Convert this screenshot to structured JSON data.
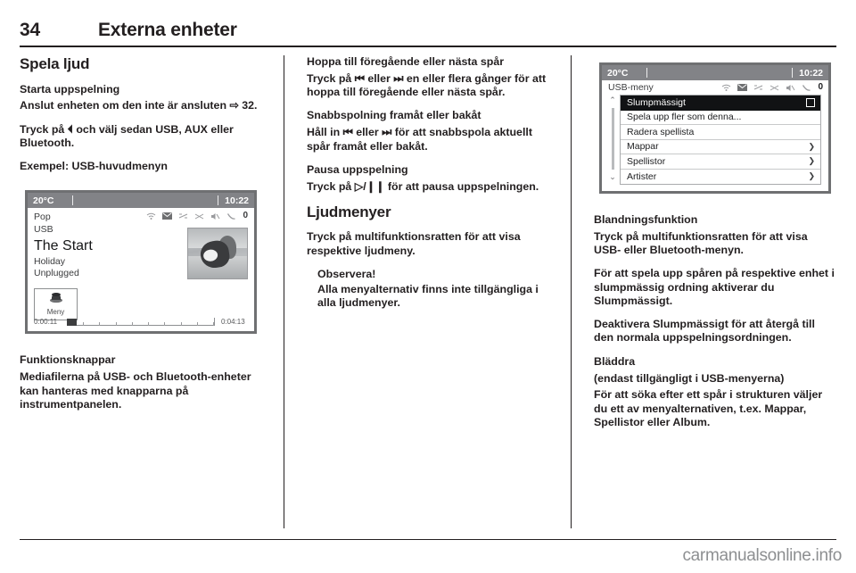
{
  "header": {
    "page_number": "34",
    "title": "Externa enheter"
  },
  "column1": {
    "section_title": "Spela ljud",
    "sub1": "Starta uppspelning",
    "para1": "Anslut enheten om den inte är ansluten ⇨ 32.",
    "para2": "Tryck på ⏴ och välj sedan USB, AUX eller Bluetooth.",
    "caption": "Exempel: USB-huvudmenyn",
    "sub2": "Funktionsknappar",
    "para3": "Mediafilerna på USB- och Bluetooth-enheter kan hanteras med knapparna på instrumentpanelen."
  },
  "player_screen": {
    "temperature": "20°C",
    "clock": "10:22",
    "genre": "Pop",
    "source": "USB",
    "track_title": "The Start",
    "album": "Holiday",
    "artist": "Unplugged",
    "menu_button_label": "Meny",
    "elapsed_time": "0:00:11",
    "total_time": "0:04:13",
    "status_icons": [
      "wifi-icon",
      "envelope-icon",
      "repeat-off-icon",
      "shuffle-icon",
      "mute-icon",
      "phone-icon",
      "battery-icon"
    ],
    "battery_label": "0"
  },
  "column2": {
    "sub1": "Hoppa till föregående eller nästa spår",
    "para1": "Tryck på ⏮ eller ⏭ en eller flera gånger för att hoppa till föregående eller nästa spår.",
    "sub2": "Snabbspolning framåt eller bakåt",
    "para2": "Håll in ⏮ eller ⏭ för att snabbspola aktuellt spår framåt eller bakåt.",
    "sub3": "Pausa uppspelning",
    "para3": "Tryck på ▷/❙❙ för att pausa uppspelningen.",
    "section_title": "Ljudmenyer",
    "para4": "Tryck på multifunktionsratten för att visa respektive ljudmeny.",
    "note_title": "Observera!",
    "note_text": "Alla menyalternativ finns inte tillgängliga i alla ljudmenyer."
  },
  "menu_screen": {
    "temperature": "20°C",
    "clock": "10:22",
    "menu_title": "USB-meny",
    "battery_label": "0",
    "status_icons": [
      "wifi-icon",
      "envelope-icon",
      "repeat-off-icon",
      "shuffle-icon",
      "mute-icon",
      "phone-icon",
      "battery-icon"
    ],
    "items": [
      {
        "label": "Slumpmässigt",
        "selected": true,
        "control": "checkbox"
      },
      {
        "label": "Spela upp fler som denna...",
        "selected": false,
        "control": "none"
      },
      {
        "label": "Radera  spellista",
        "selected": false,
        "control": "none"
      },
      {
        "label": "Mappar",
        "selected": false,
        "control": "arrow"
      },
      {
        "label": "Spellistor",
        "selected": false,
        "control": "arrow"
      },
      {
        "label": "Artister",
        "selected": false,
        "control": "arrow"
      }
    ],
    "scroll_up": "⌃",
    "scroll_down": "⌄"
  },
  "column3": {
    "sub1": "Blandningsfunktion",
    "para1": "Tryck på multifunktionsratten för att visa USB- eller Bluetooth-menyn.",
    "para2": "För att spela upp spåren på respektive enhet i slumpmässig ordning aktiverar du Slumpmässigt.",
    "para3": "Deaktivera Slumpmässigt för att återgå till den normala uppspelningsordningen.",
    "sub2": "Bläddra",
    "sub2_note": "(endast tillgängligt i USB-menyerna)",
    "para4": "För att söka efter ett spår i strukturen väljer du ett av menyalternativen, t.ex. Mappar, Spellistor eller Album."
  },
  "footer": {
    "watermark": "carmanualsonline.info"
  },
  "colors": {
    "text": "#231f20",
    "status_bar": "#828387",
    "selected_row": "#111214",
    "watermark": "#8d8f91"
  }
}
